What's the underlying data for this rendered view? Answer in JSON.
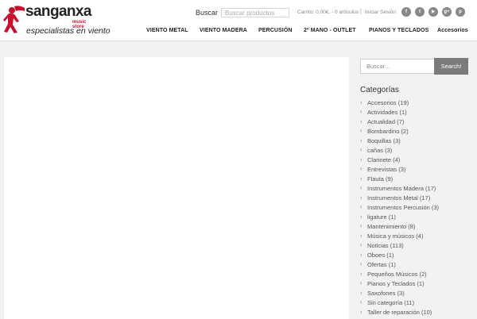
{
  "header": {
    "logo": {
      "name": "sanganxa",
      "sub": "music store",
      "tagline": "especialistas en viento",
      "brand_color": "#c8102e"
    },
    "search_label": "Buscar",
    "search_placeholder": "Buscar productos",
    "cart_text": "Carrito: 0,00€,  - 0 artículos",
    "separator": "|",
    "login_label": "Iniciar Sesión",
    "social": [
      {
        "icon": "facebook-icon",
        "glyph": "f"
      },
      {
        "icon": "twitter-icon",
        "glyph": "t"
      },
      {
        "icon": "youtube-icon",
        "glyph": "▶"
      },
      {
        "icon": "googleplus-icon",
        "glyph": "g+"
      },
      {
        "icon": "pinterest-icon",
        "glyph": "p"
      }
    ]
  },
  "nav": {
    "items": [
      "VIENTO METAL",
      "VIENTO MADERA",
      "PERCUSIÓN",
      "2º MANO - OUTLET",
      "PIANOS Y TECLADOS",
      "Accesorios"
    ]
  },
  "sidebar": {
    "search_placeholder": "Buscar...",
    "search_button": "Search!",
    "categories_title": "Categorías",
    "categories": [
      {
        "label": "Accesorios",
        "count": "(19)"
      },
      {
        "label": "Actividades",
        "count": "(1)"
      },
      {
        "label": "Actualidad",
        "count": "(7)"
      },
      {
        "label": "Bombardino",
        "count": "(2)"
      },
      {
        "label": "Boquillas",
        "count": "(3)"
      },
      {
        "label": "cañas",
        "count": "(3)"
      },
      {
        "label": "Clarinete",
        "count": "(4)"
      },
      {
        "label": "Entrevistas",
        "count": "(3)"
      },
      {
        "label": "Flauta",
        "count": "(9)"
      },
      {
        "label": "Instrumentos Madera",
        "count": "(17)"
      },
      {
        "label": "Instrumentos Metal",
        "count": "(17)"
      },
      {
        "label": "Instrumentos Percusión",
        "count": "(3)"
      },
      {
        "label": "ligature",
        "count": "(1)"
      },
      {
        "label": "Mantenimiento",
        "count": "(8)"
      },
      {
        "label": "Música y músicos",
        "count": "(4)"
      },
      {
        "label": "Noticias",
        "count": "(113)"
      },
      {
        "label": "Oboes",
        "count": "(1)"
      },
      {
        "label": "Ofertas",
        "count": "(1)"
      },
      {
        "label": "Pequeños Músicos",
        "count": "(2)"
      },
      {
        "label": "Pianos y Teclados",
        "count": "(1)"
      },
      {
        "label": "Saxofones",
        "count": "(3)"
      },
      {
        "label": "Sin categoría",
        "count": "(11)"
      },
      {
        "label": "Taller de reparación",
        "count": "(10)"
      }
    ]
  }
}
